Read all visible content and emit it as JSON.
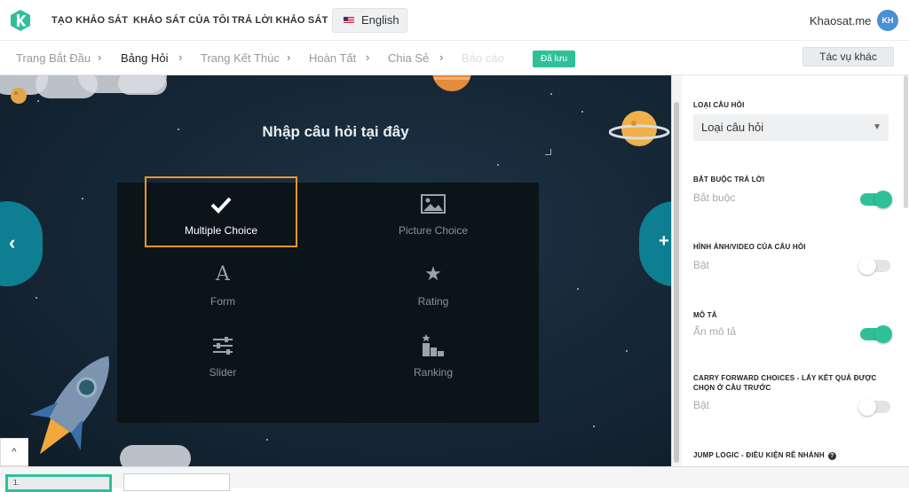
{
  "topnav": {
    "items": [
      "TẠO KHẢO SÁT",
      "KHẢO SÁT CỦA TÔI",
      "TRẢ LỜI KHẢO SÁT"
    ],
    "language": "English",
    "brand": "Khaosat.me",
    "avatar_initials": "KH"
  },
  "breadcrumb": {
    "steps": [
      "Trang Bắt Đầu",
      "Bảng Hỏi",
      "Trang Kết Thúc",
      "Hoàn Tất",
      "Chia Sẻ",
      "Báo cáo"
    ],
    "active_index": 1,
    "saved_badge": "Đã lưu",
    "other_tasks": "Tác vụ khác"
  },
  "editor": {
    "question_placeholder": "Nhập câu hỏi tại đây",
    "question_types": [
      {
        "label": "Multiple Choice",
        "icon": "check-icon",
        "selected": true
      },
      {
        "label": "Picture Choice",
        "icon": "image-icon",
        "selected": false
      },
      {
        "label": "Form",
        "icon": "form-letter-icon",
        "selected": false
      },
      {
        "label": "Rating",
        "icon": "star-icon",
        "selected": false
      },
      {
        "label": "Slider",
        "icon": "sliders-icon",
        "selected": false
      },
      {
        "label": "Ranking",
        "icon": "ranking-icon",
        "selected": false
      }
    ]
  },
  "thumbnails": {
    "first_label": "1."
  },
  "settings": {
    "question_type_title": "LOẠI CÂU HỎI",
    "question_type_value": "Loại câu hỏi",
    "required_title": "BẮT BUỘC TRẢ LỜI",
    "required_value": "Bắt buộc",
    "required_on": true,
    "media_title": "HÌNH ẢNH/VIDEO CỦA CÂU HỎI",
    "media_value": "Bật",
    "media_on": false,
    "description_title": "MÔ TẢ",
    "description_value": "Ẩn mô tả",
    "description_on": true,
    "carry_title_line1": "CARRY FORWARD CHOICES - LẤY KẾT QUẢ ĐƯỢC",
    "carry_title_line2": "CHỌN Ở CÂU TRƯỚC",
    "carry_value": "Bật",
    "carry_on": false,
    "jump_title": "JUMP LOGIC - ĐIỀU KIỆN RẼ NHÁNH",
    "help_glyph": "?"
  },
  "colors": {
    "accent": "#2fc09a",
    "selected_border": "#f0962a",
    "nav_round": "#0e7f92"
  }
}
